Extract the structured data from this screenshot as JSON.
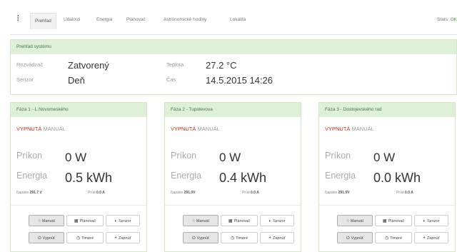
{
  "nav": {
    "items": [
      {
        "label": "Prehľad",
        "active": true
      },
      {
        "label": "Udalosti",
        "active": false
      },
      {
        "label": "Energia",
        "active": false
      },
      {
        "label": "Plánovač",
        "active": false
      },
      {
        "label": "Astronomické hodiny",
        "active": false
      },
      {
        "label": "Lokalita",
        "active": false
      }
    ],
    "status_label": "Stats:",
    "status_value": "OK"
  },
  "overview": {
    "title": "Prehľad systému",
    "switchboard_label": "Rozvádzač",
    "switchboard_value": "Zatvorený",
    "sensor_label": "Senzor",
    "sensor_value": "Deň",
    "temp_label": "Teplota",
    "temp_value": "27.2 °C",
    "time_label": "Čas",
    "time_value": "14.5.2015 14:26"
  },
  "phases": [
    {
      "title": "Fáza 1 - L.Novomeského",
      "state_off": "VYPNUTÁ",
      "state_mode": "MANUÁL",
      "power_label": "Príkon",
      "power_value": "0 W",
      "energy_label": "Energia",
      "energy_value": "0.5 kWh",
      "voltage_label": "Napätie",
      "voltage_value": "291.7 V",
      "current_label": "Prúd",
      "current_value": "0.0 A"
    },
    {
      "title": "Fáza 2 - Tupolevova",
      "state_off": "VYPNUTÁ",
      "state_mode": "MANUÁL",
      "power_label": "Príkon",
      "power_value": "0 W",
      "energy_label": "Energia",
      "energy_value": "0.4 kWh",
      "voltage_label": "Napätie",
      "voltage_value": "291.0V",
      "current_label": "Prúd",
      "current_value": "0.0 A"
    },
    {
      "title": "Fáza 3 - Dostojevského rad",
      "state_off": "VYPNUTÁ",
      "state_mode": "MANUÁL",
      "power_label": "Príkon",
      "power_value": "0 W",
      "energy_label": "Energia",
      "energy_value": "0.0 kWh",
      "voltage_label": "Napätie",
      "voltage_value": "291.9V",
      "current_label": "Prúd",
      "current_value": "0.0 A"
    }
  ],
  "buttons": {
    "manual": "Manuál",
    "planner": "Plánovač",
    "sensor": "Senzor",
    "off": "Vypnúť",
    "timer": "Timeré",
    "on": "Zapnúť"
  },
  "icons": {
    "manual": "hand-icon",
    "planner": "calendar-icon",
    "sensor": "half-circle-icon",
    "off": "power-icon",
    "timer": "clock-icon",
    "on": "plus-icon"
  },
  "colors": {
    "panel_header_bg": "#dff0d8",
    "panel_header_text": "#3c763d",
    "state_off": "#c9302c"
  }
}
